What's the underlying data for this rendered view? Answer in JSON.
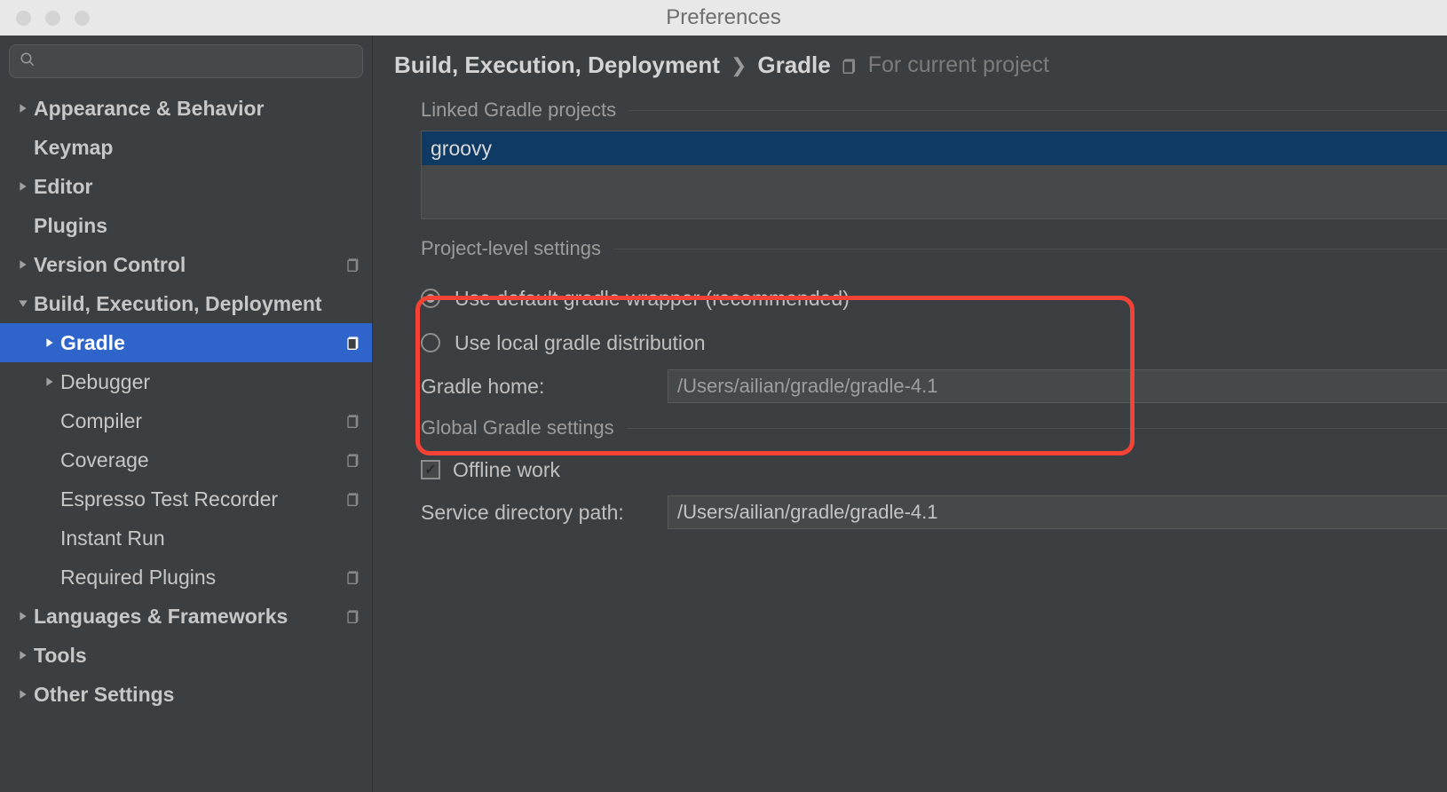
{
  "window": {
    "title": "Preferences"
  },
  "sidebar": {
    "search_placeholder": "",
    "items": [
      {
        "label": "Appearance & Behavior",
        "indent": 0,
        "arrow": "right",
        "bold": true,
        "proj": false
      },
      {
        "label": "Keymap",
        "indent": 0,
        "arrow": "none",
        "bold": true,
        "proj": false
      },
      {
        "label": "Editor",
        "indent": 0,
        "arrow": "right",
        "bold": true,
        "proj": false
      },
      {
        "label": "Plugins",
        "indent": 0,
        "arrow": "none",
        "bold": true,
        "proj": false
      },
      {
        "label": "Version Control",
        "indent": 0,
        "arrow": "right",
        "bold": true,
        "proj": true
      },
      {
        "label": "Build, Execution, Deployment",
        "indent": 0,
        "arrow": "down",
        "bold": true,
        "proj": false
      },
      {
        "label": "Gradle",
        "indent": 1,
        "arrow": "right",
        "bold": true,
        "proj": true,
        "selected": true
      },
      {
        "label": "Debugger",
        "indent": 1,
        "arrow": "right",
        "bold": false,
        "proj": false
      },
      {
        "label": "Compiler",
        "indent": 1,
        "arrow": "none",
        "bold": false,
        "proj": true
      },
      {
        "label": "Coverage",
        "indent": 1,
        "arrow": "none",
        "bold": false,
        "proj": true
      },
      {
        "label": "Espresso Test Recorder",
        "indent": 1,
        "arrow": "none",
        "bold": false,
        "proj": true
      },
      {
        "label": "Instant Run",
        "indent": 1,
        "arrow": "none",
        "bold": false,
        "proj": false
      },
      {
        "label": "Required Plugins",
        "indent": 1,
        "arrow": "none",
        "bold": false,
        "proj": true
      },
      {
        "label": "Languages & Frameworks",
        "indent": 0,
        "arrow": "right",
        "bold": true,
        "proj": true
      },
      {
        "label": "Tools",
        "indent": 0,
        "arrow": "right",
        "bold": true,
        "proj": false
      },
      {
        "label": "Other Settings",
        "indent": 0,
        "arrow": "right",
        "bold": true,
        "proj": false
      }
    ]
  },
  "breadcrumb": {
    "part1": "Build, Execution, Deployment",
    "part2": "Gradle",
    "scope": "For current project"
  },
  "sections": {
    "linked_title": "Linked Gradle projects",
    "linked_item": "groovy",
    "project_level_title": "Project-level settings",
    "radio_default": "Use default gradle wrapper (recommended)",
    "radio_local": "Use local gradle distribution",
    "gradle_home_label": "Gradle home:",
    "gradle_home_value": "/Users/ailian/gradle/gradle-4.1",
    "global_title": "Global Gradle settings",
    "offline_label": "Offline work",
    "service_dir_label": "Service directory path:",
    "service_dir_value": "/Users/ailian/gradle/gradle-4.1"
  }
}
